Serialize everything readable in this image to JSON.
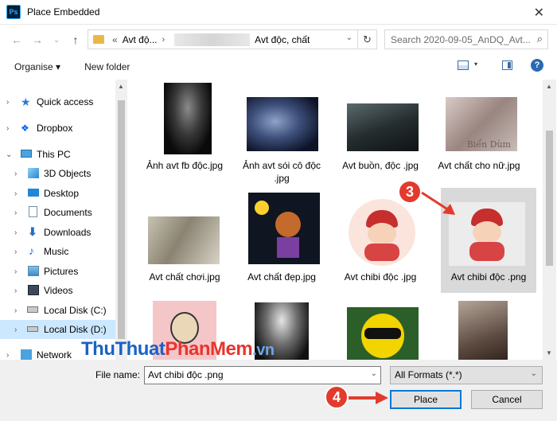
{
  "window": {
    "title": "Place Embedded",
    "app_icon": "Ps",
    "close_glyph": "✕"
  },
  "nav": {
    "path_prefix": "«",
    "path_segment1": "Avt độ...",
    "path_segment2": "Avt độc, chất",
    "search_placeholder": "Search 2020-09-05_AnDQ_Avt..."
  },
  "toolbar": {
    "organise": "Organise ▾",
    "new_folder": "New folder",
    "help": "?"
  },
  "sidebar": {
    "items": [
      {
        "label": "Quick access",
        "icon": "star-icon"
      },
      {
        "label": "Dropbox",
        "icon": "dropbox-icon"
      },
      {
        "label": "This PC",
        "icon": "computer-icon"
      },
      {
        "label": "3D Objects",
        "icon": "cube-icon"
      },
      {
        "label": "Desktop",
        "icon": "desktop-icon"
      },
      {
        "label": "Documents",
        "icon": "documents-icon"
      },
      {
        "label": "Downloads",
        "icon": "download-icon"
      },
      {
        "label": "Music",
        "icon": "music-icon"
      },
      {
        "label": "Pictures",
        "icon": "pictures-icon"
      },
      {
        "label": "Videos",
        "icon": "videos-icon"
      },
      {
        "label": "Local Disk (C:)",
        "icon": "disk-icon"
      },
      {
        "label": "Local Disk (D:)",
        "icon": "disk-icon"
      },
      {
        "label": "Network",
        "icon": "network-icon"
      }
    ]
  },
  "files": [
    {
      "name": "Ảnh avt fb độc.jpg"
    },
    {
      "name": "Ảnh avt sói cô độc .jpg"
    },
    {
      "name": "Avt buồn, độc .jpg"
    },
    {
      "name": "Avt chất cho nữ.jpg"
    },
    {
      "name": "Avt chất chơi.jpg"
    },
    {
      "name": "Avt chất đẹp.jpg"
    },
    {
      "name": "Avt chibi độc .jpg"
    },
    {
      "name": "Avt chibi độc .png"
    },
    {
      "name": ""
    },
    {
      "name": ""
    },
    {
      "name": ""
    },
    {
      "name": ""
    }
  ],
  "thumb_caption": "Biển Dùm",
  "bottom": {
    "filename_label": "File name:",
    "filename_value": "Avt chibi độc .png",
    "format": "All Formats (*.*)",
    "place": "Place",
    "cancel": "Cancel"
  },
  "watermark": {
    "part1": "Thu",
    "part2": "Thuat",
    "part3": "PhanMem",
    "part4": ".vn"
  },
  "steps": {
    "step3": "3",
    "step4": "4"
  },
  "colors": {
    "accent": "#0078d7",
    "step_badge": "#e23b2e",
    "selection": "#cce8ff"
  }
}
